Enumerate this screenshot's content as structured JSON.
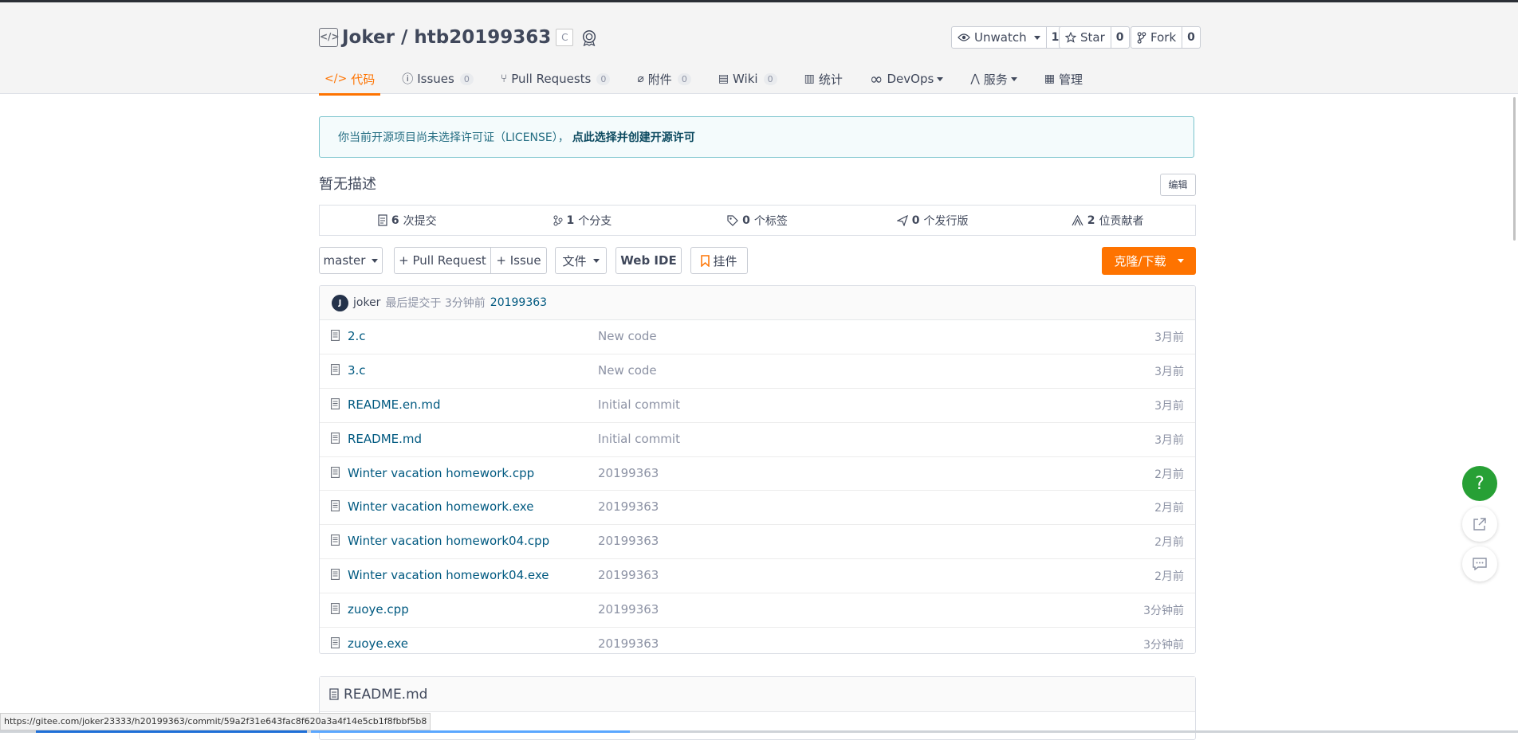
{
  "repo": {
    "owner_name": "Joker / htb20199363",
    "lang_badge": "C",
    "unwatch": {
      "label": "Unwatch",
      "count": "1"
    },
    "star": {
      "label": "Star",
      "count": "0"
    },
    "fork": {
      "label": "Fork",
      "count": "0"
    }
  },
  "tabs": [
    {
      "label": "代码",
      "icon": "code-icon"
    },
    {
      "label": "Issues",
      "count": "0",
      "icon": "issue-icon"
    },
    {
      "label": "Pull Requests",
      "count": "0",
      "icon": "pr-icon"
    },
    {
      "label": "附件",
      "count": "0",
      "icon": "attachment-icon"
    },
    {
      "label": "Wiki",
      "count": "0",
      "icon": "wiki-icon"
    },
    {
      "label": "统计",
      "icon": "stats-icon"
    },
    {
      "label": "DevOps",
      "icon": "devops-icon"
    },
    {
      "label": "服务",
      "icon": "service-icon"
    },
    {
      "label": "管理",
      "icon": "manage-icon"
    }
  ],
  "notice": {
    "text": "你当前开源项目尚未选择许可证（LICENSE），",
    "link": "点此选择并创建开源许可"
  },
  "description": "暂无描述",
  "edit_label": "编辑",
  "stats": [
    {
      "num": "6",
      "label": "次提交"
    },
    {
      "num": "1",
      "label": "个分支"
    },
    {
      "num": "0",
      "label": "个标签"
    },
    {
      "num": "0",
      "label": "个发行版"
    },
    {
      "num": "2",
      "label": "位贡献者"
    }
  ],
  "toolbar": {
    "branch": "master",
    "pull_request": "+ Pull Request",
    "issue": "+ Issue",
    "file_menu": "文件",
    "web_ide": "Web IDE",
    "widget": "挂件",
    "clone": "克隆/下载"
  },
  "last_commit": {
    "avatar": "J",
    "author": "joker",
    "text": "最后提交于 3分钟前",
    "message": "20199363"
  },
  "files": [
    {
      "name": "2.c",
      "message": "New code",
      "time": "3月前"
    },
    {
      "name": "3.c",
      "message": "New code",
      "time": "3月前"
    },
    {
      "name": "README.en.md",
      "message": "Initial commit",
      "time": "3月前"
    },
    {
      "name": "README.md",
      "message": "Initial commit",
      "time": "3月前"
    },
    {
      "name": "Winter vacation homework.cpp",
      "message": "20199363",
      "time": "2月前"
    },
    {
      "name": "Winter vacation homework.exe",
      "message": "20199363",
      "time": "2月前"
    },
    {
      "name": "Winter vacation homework04.cpp",
      "message": "20199363",
      "time": "2月前"
    },
    {
      "name": "Winter vacation homework04.exe",
      "message": "20199363",
      "time": "2月前"
    },
    {
      "name": "zuoye.cpp",
      "message": "20199363",
      "time": "3分钟前"
    },
    {
      "name": "zuoye.exe",
      "message": "20199363",
      "time": "3分钟前"
    }
  ],
  "readme_title": "README.md",
  "fab": {
    "help": "?"
  },
  "status_url": "https://gitee.com/joker23333/h20199363/commit/59a2f31e643fac8f620a3a4f14e5cb1f8fbbf5b8",
  "colors": {
    "accent": "#fe7300",
    "link": "#005980",
    "help": "#27a035"
  }
}
